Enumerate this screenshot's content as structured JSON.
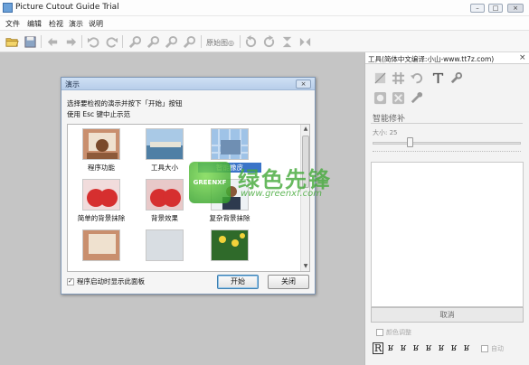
{
  "window": {
    "title": "Picture Cutout Guide Trial",
    "controls": {
      "minimize": "–",
      "maximize": "□",
      "close": "×"
    }
  },
  "menu": [
    "文件",
    "编辑",
    "检视",
    "演示",
    "说明"
  ],
  "toolbar": {
    "label": "原始图◎",
    "icons": [
      "open-folder-icon",
      "save-icon",
      "back-arrow-icon",
      "forward-arrow-icon",
      "undo-icon",
      "redo-icon",
      "zoom-in-icon",
      "zoom-out-icon",
      "zoom-fit-icon",
      "zoom-reset-icon",
      "rotate-left-icon",
      "rotate-right-icon",
      "flip-vertical-icon",
      "flip-horizontal-icon"
    ]
  },
  "dialog": {
    "title": "演示",
    "close": "×",
    "instruction_line1": "选择要检视的演示并按下「开始」按钮",
    "instruction_line2": "使用 Esc 键中止示范",
    "items": [
      {
        "label": "程序功能"
      },
      {
        "label": "工具大小"
      },
      {
        "label": "智能橡皮",
        "selected": true
      },
      {
        "label": "简单的背景抹除"
      },
      {
        "label": "背景效果"
      },
      {
        "label": "复杂背景抹除"
      },
      {
        "label": ""
      },
      {
        "label": ""
      },
      {
        "label": ""
      }
    ],
    "checkbox_label": "程序启动时显示此面板",
    "checkbox_checked": true,
    "start_button": "开始",
    "close_button": "关闭"
  },
  "tools_panel": {
    "title": "工具(简体中文编译:小山-www.tt7z.com)",
    "close": "×",
    "smart_label": "智能修补",
    "size_label": "大小: 25",
    "size_value": 25,
    "cancel_button": "取消",
    "color_adjust_label": "颜色调整",
    "glyphs": [
      "R",
      "ʁ",
      "ʁ",
      "ʁ",
      "ʁ",
      "ʁ",
      "ʁ",
      "ʁ",
      "ʁ"
    ],
    "auto_label": "自动"
  },
  "watermark": {
    "logo_text": "GREENXF",
    "text": "绿色先锋",
    "url": "www.greenxf.com"
  }
}
